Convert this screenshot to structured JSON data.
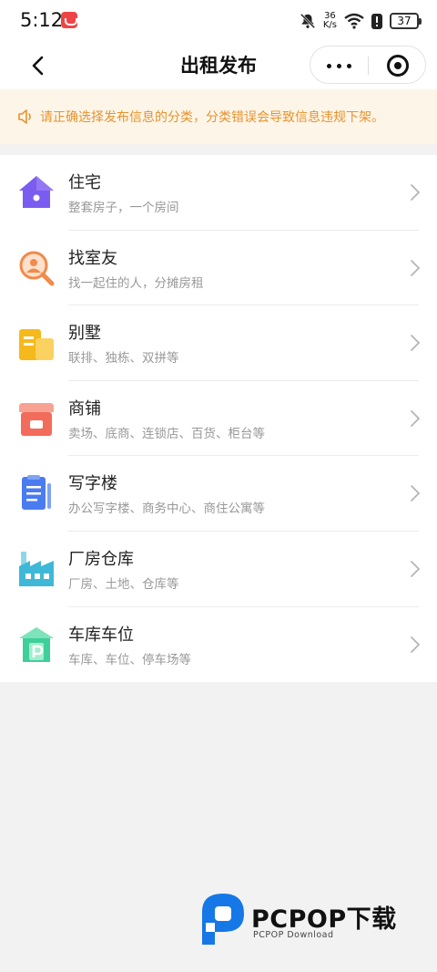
{
  "status_bar": {
    "time": "5:12",
    "net_speed_value": "36",
    "net_speed_unit": "K/s",
    "battery": "37",
    "icons": [
      "app-badge-icon",
      "bell-off-icon",
      "wifi-icon",
      "charging-alert-icon",
      "battery-icon"
    ]
  },
  "nav": {
    "title": "出租发布",
    "back_icon": "back-arrow-icon",
    "more_icon": "more-dots-icon",
    "close_icon": "target-close-icon"
  },
  "notice": {
    "icon": "speaker-icon",
    "text": "请正确选择发布信息的分类，分类错误会导致信息违规下架。"
  },
  "categories": [
    {
      "title": "住宅",
      "subtitle": "整套房子，一个房间",
      "icon": "house-icon"
    },
    {
      "title": "找室友",
      "subtitle": "找一起住的人，分摊房租",
      "icon": "search-person-icon"
    },
    {
      "title": "别墅",
      "subtitle": "联排、独栋、双拼等",
      "icon": "villa-icon"
    },
    {
      "title": "商铺",
      "subtitle": "卖场、底商、连锁店、百货、柜台等",
      "icon": "shop-icon"
    },
    {
      "title": "写字楼",
      "subtitle": "办公写字楼、商务中心、商住公寓等",
      "icon": "office-icon"
    },
    {
      "title": "厂房仓库",
      "subtitle": "厂房、土地、仓库等",
      "icon": "factory-icon"
    },
    {
      "title": "车库车位",
      "subtitle": "车库、车位、停车场等",
      "icon": "garage-icon"
    }
  ],
  "watermark": {
    "title": "PCPOP下载",
    "subtitle": "PCPOP Download"
  },
  "colors": {
    "notice_bg": "#fdf6e8",
    "notice_text": "#e8922e",
    "house": "#7b5cf0",
    "search": "#f28a4a",
    "villa": "#f5b91c",
    "shop": "#f26b5b",
    "office": "#4a7cf0",
    "factory": "#3fb8d8",
    "garage": "#3fcf9a",
    "watermark_blue": "#1677e6"
  }
}
